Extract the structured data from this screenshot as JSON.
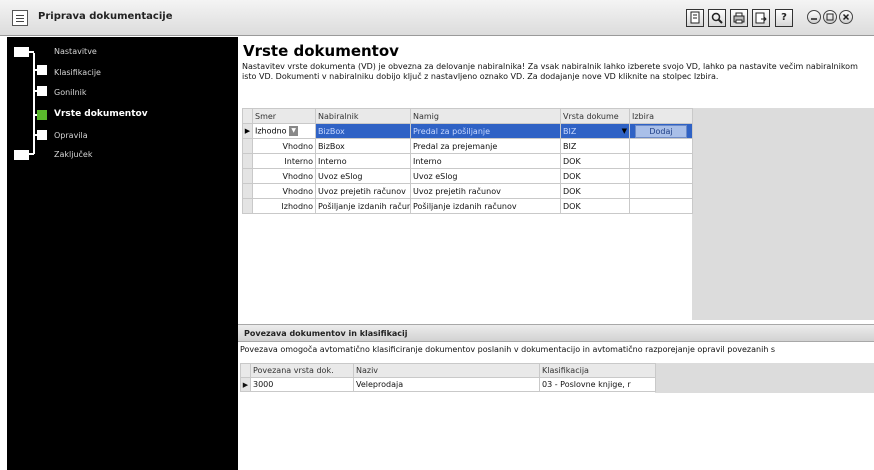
{
  "window": {
    "title": "Priprava dokumentacije",
    "toolbar_icons": [
      "document-icon",
      "search-icon",
      "print-icon",
      "export-icon"
    ],
    "help_label": "?"
  },
  "sidebar": {
    "items": [
      {
        "label": "Nastavitve",
        "active": false
      },
      {
        "label": "Klasifikacije",
        "active": false
      },
      {
        "label": "Gonilnik",
        "active": false
      },
      {
        "label": "Vrste dokumentov",
        "active": true
      },
      {
        "label": "Opravila",
        "active": false
      },
      {
        "label": "Zaključek",
        "active": false
      }
    ]
  },
  "main": {
    "title": "Vrste dokumentov",
    "description": "Nastavitev vrste dokumenta (VD) je obvezna za delovanje nabiralnika! Za vsak nabiralnik lahko izberete svojo VD, lahko pa nastavite večim nabiralnikom isto VD. Dokumenti v nabiralniku dobijo ključ z nastavljeno oznako VD. Za dodajanje nove VD kliknite na stolpec Izbira.",
    "grid": {
      "columns": [
        "Smer",
        "Nabiralnik",
        "Namig",
        "Vrsta dokume",
        "Izbira"
      ],
      "rows": [
        {
          "smer": "Izhodno",
          "nabiralnik": "BizBox",
          "namig": "Predal za pošiljanje",
          "vrsta": "BIZ",
          "izbira": "Dodaj",
          "selected": true
        },
        {
          "smer": "Vhodno",
          "nabiralnik": "BizBox",
          "namig": "Predal za prejemanje",
          "vrsta": "BIZ",
          "izbira": "",
          "selected": false
        },
        {
          "smer": "Interno",
          "nabiralnik": "Interno",
          "namig": "Interno",
          "vrsta": "DOK",
          "izbira": "",
          "selected": false
        },
        {
          "smer": "Vhodno",
          "nabiralnik": "Uvoz eSlog",
          "namig": "Uvoz eSlog",
          "vrsta": "DOK",
          "izbira": "",
          "selected": false
        },
        {
          "smer": "Vhodno",
          "nabiralnik": "Uvoz prejetih računov",
          "namig": "Uvoz prejetih računov",
          "vrsta": "DOK",
          "izbira": "",
          "selected": false
        },
        {
          "smer": "Izhodno",
          "nabiralnik": "Pošiljanje izdanih računov",
          "namig": "Pošiljanje izdanih računov",
          "vrsta": "DOK",
          "izbira": "",
          "selected": false
        }
      ]
    }
  },
  "links": {
    "title": "Povezava dokumentov in klasifikacij",
    "description": "Povezava omogoča avtomatično klasificiranje dokumentov poslanih v dokumentacijo in avtomatično razporejanje opravil povezanih s",
    "grid": {
      "columns": [
        "Povezana vrsta dok.",
        "Naziv",
        "Klasifikacija"
      ],
      "rows": [
        {
          "vrsta": "3000",
          "naziv": "Veleprodaja",
          "klasifikacija": "03 - Poslovne knjige, r"
        }
      ]
    }
  }
}
